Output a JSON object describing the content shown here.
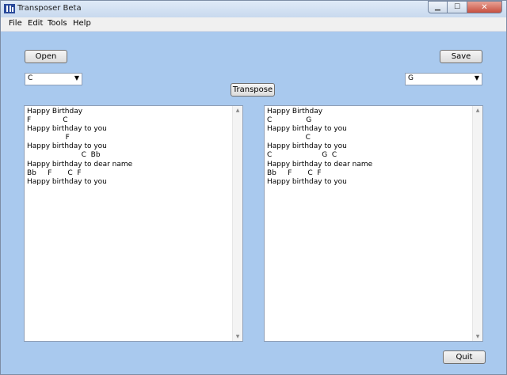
{
  "window": {
    "title": "Transposer Beta"
  },
  "menu": [
    "File",
    "Edit",
    "Tools",
    "Help"
  ],
  "buttons": {
    "open": "Open",
    "save": "Save",
    "transpose": "Transpose",
    "quit": "Quit"
  },
  "source_key": "C",
  "target_key": "G",
  "source_text": "Happy Birthday\nF              C\nHappy birthday to you\n                 F\nHappy birthday to you\n                        C  Bb\nHappy birthday to dear name\nBb     F       C  F\nHappy birthday to you",
  "target_text": "Happy Birthday\nC               G\nHappy birthday to you\n                 C\nHappy birthday to you\nC                      G  C\nHappy birthday to dear name\nBb     F       C  F\nHappy birthday to you",
  "icons": [
    "app-icon",
    "minimize-icon",
    "maximize-icon",
    "close-icon",
    "chevron-down-icon",
    "scroll-up-icon",
    "scroll-down-icon"
  ]
}
